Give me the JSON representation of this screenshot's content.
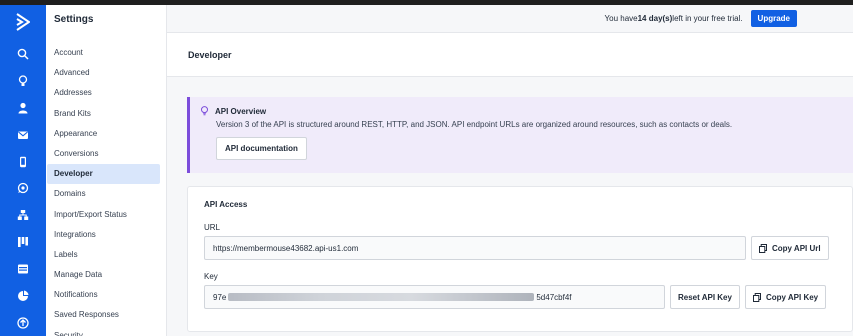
{
  "menu": {
    "title": "Settings",
    "items": [
      {
        "label": "Account"
      },
      {
        "label": "Advanced"
      },
      {
        "label": "Addresses"
      },
      {
        "label": "Brand Kits"
      },
      {
        "label": "Appearance"
      },
      {
        "label": "Conversions"
      },
      {
        "label": "Developer",
        "active": true
      },
      {
        "label": "Domains"
      },
      {
        "label": "Import/Export Status"
      },
      {
        "label": "Integrations"
      },
      {
        "label": "Labels"
      },
      {
        "label": "Manage Data"
      },
      {
        "label": "Notifications"
      },
      {
        "label": "Saved Responses"
      },
      {
        "label": "Security"
      }
    ]
  },
  "rail": {
    "icons": [
      "logo-icon",
      "search-icon",
      "lightbulb-icon",
      "contacts-icon",
      "email-icon",
      "phone-icon",
      "whatsapp-icon",
      "automations-icon",
      "deals-icon",
      "website-icon",
      "reports-icon",
      "apps-icon"
    ]
  },
  "banner": {
    "text_before": "You have ",
    "days": "14 day(s)",
    "text_after": " left in your free trial.",
    "upgrade_label": "Upgrade"
  },
  "page": {
    "title": "Developer"
  },
  "overview": {
    "title": "API Overview",
    "description": "Version 3 of the API is structured around REST, HTTP, and JSON. API endpoint URLs are organized around resources, such as contacts or deals.",
    "button_label": "API documentation"
  },
  "access": {
    "title": "API Access",
    "url_label": "URL",
    "url_value": "https://membermouse43682.api-us1.com",
    "copy_url_label": "Copy API Url",
    "key_label": "Key",
    "key_prefix": "97e",
    "key_suffix": "5d47cbf4f",
    "reset_key_label": "Reset API Key",
    "copy_key_label": "Copy API Key"
  },
  "colors": {
    "brand": "#1160e3",
    "accent_purple": "#7c4ddb"
  }
}
